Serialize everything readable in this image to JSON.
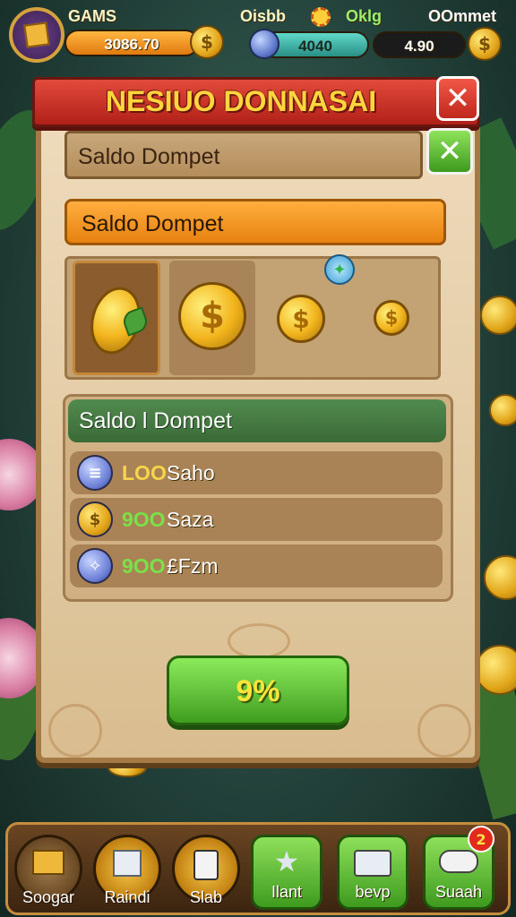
{
  "hud": {
    "game_label": "GAMS",
    "balance": "3086.70",
    "player_label": "Oisbb",
    "bkle_label": "Oklg",
    "right_label": "OOmmet",
    "gem_value": "4040",
    "dark_value": "4.90"
  },
  "dialog": {
    "title": "NESIUO DONNASAI",
    "header": "Saldo Dompet",
    "section_title": "Saldo Dompet",
    "list_title": "Saldo l Dompet",
    "rows": [
      {
        "amount": "LOO",
        "name": "Saho",
        "amount_color": "#f6d54a",
        "icon": "gem-icon"
      },
      {
        "amount": "9OO",
        "name": "Saza",
        "amount_color": "#7be04a",
        "icon": "coin-icon"
      },
      {
        "amount": "9OO",
        "name": "£Fzm",
        "amount_color": "#7be04a",
        "icon": "gem-icon"
      }
    ],
    "confirm_label": "9%"
  },
  "nav": [
    {
      "label": "Soogar",
      "icon": "treasure-chest-icon"
    },
    {
      "label": "Raindi",
      "icon": "card-stack-icon"
    },
    {
      "label": "Slab",
      "icon": "scroll-icon"
    },
    {
      "label": "Ilant",
      "icon": "star-icon"
    },
    {
      "label": "bevp",
      "icon": "megaphone-icon"
    },
    {
      "label": "Suaah",
      "icon": "chat-icon"
    }
  ],
  "notification_count": "2",
  "colors": {
    "banner": "#c8281c",
    "accent_gold": "#ffd53d",
    "confirm_green": "#5bbf2a",
    "panel": "#e4caa0"
  }
}
